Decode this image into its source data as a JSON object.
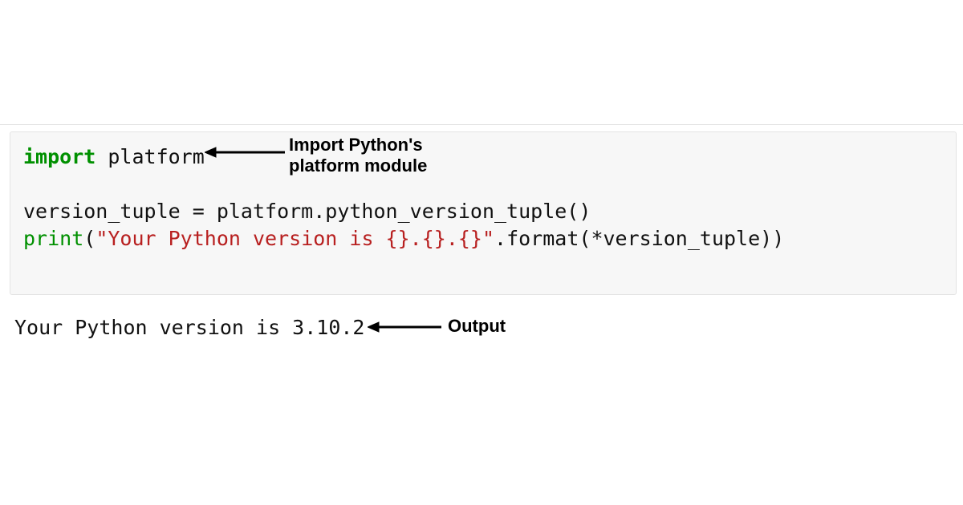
{
  "annotations": {
    "import_label_line1": "Import Python's",
    "import_label_line2": "platform module",
    "output_label": "Output"
  },
  "code": {
    "line1": {
      "kw": "import",
      "module": " platform"
    },
    "blank1": "",
    "line2": "version_tuple = platform.python_version_tuple()",
    "line3": {
      "fn": "print",
      "open": "(",
      "str": "\"Your Python version is {}.{}.{}\"",
      "rest": ".format(*version_tuple))"
    }
  },
  "output": "Your Python version is 3.10.2",
  "python_version": "3.10.2"
}
